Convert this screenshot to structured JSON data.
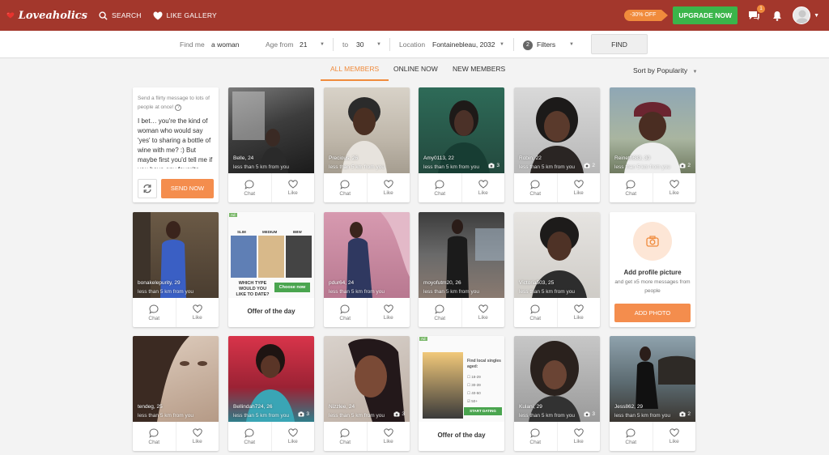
{
  "header": {
    "brand": "Loveaholics",
    "search_label": "SEARCH",
    "like_gallery_label": "LIKE GALLERY",
    "promo_label": "-30% OFF",
    "upgrade_label": "UPGRADE NOW",
    "messages_badge": "1",
    "accent_color": "#a3372c"
  },
  "filters": {
    "find_me_label": "Find me",
    "find_me_value": "a woman",
    "age_from_label": "Age from",
    "age_from_value": "21",
    "age_to_label": "to",
    "age_to_value": "30",
    "location_label": "Location",
    "location_value": "Fontainebleau, 2032",
    "filters_count": "2",
    "filters_label": "Filters",
    "find_button": "FIND"
  },
  "tabs": {
    "all": "ALL MEMBERS",
    "online": "ONLINE NOW",
    "new": "NEW MEMBERS"
  },
  "sort_label": "Sort by Popularity",
  "card_actions": {
    "chat": "Chat",
    "like": "Like"
  },
  "distance_text": "less than 5 km from you",
  "message_card": {
    "hint": "Send a flirty message to lots of people at once!",
    "text": "I bet… you're the kind of woman who would say 'yes' to sharing a bottle of wine with me? :) But maybe first you'd tell me if you have any favorite",
    "send_label": "SEND NOW"
  },
  "offer": {
    "title": "Offer of the day",
    "body_types": [
      "SLIM",
      "MEDIUM",
      "BBW"
    ],
    "question": "WHICH TYPE WOULD YOU LIKE TO DATE?",
    "cta": "Choose now",
    "age_question": "Find local singles aged:",
    "age_ranges": [
      "18-29",
      "30-39",
      "40-50",
      "50+"
    ],
    "age_cta": "START DATING"
  },
  "add_picture": {
    "title": "Add profile picture",
    "subtitle": "and get x5 more messages from people",
    "button": "ADD PHOTO"
  },
  "members": {
    "belle": {
      "name": "Belle, 24"
    },
    "precious": {
      "name": "Precious, 26"
    },
    "amy": {
      "name": "Amy0113, 22",
      "photos": "3"
    },
    "robin": {
      "name": "Robin, 22",
      "photos": "2"
    },
    "reineth": {
      "name": "Reineth683, 30",
      "photos": "2"
    },
    "bonake": {
      "name": "bonakelepurity, 29"
    },
    "pdur": {
      "name": "pdur64, 24"
    },
    "moyo": {
      "name": "moyofutm20, 26"
    },
    "victoria": {
      "name": "Victoria503, 25"
    },
    "tendeg": {
      "name": "tendeg, 25"
    },
    "bellindah": {
      "name": "Bellindah724, 26",
      "photos": "3"
    },
    "nizzlee": {
      "name": "Nizzlee, 24",
      "photos": "3"
    },
    "kulani": {
      "name": "Kulani, 29",
      "photos": "3"
    },
    "jess": {
      "name": "Jess862, 29",
      "photos": "2"
    }
  }
}
